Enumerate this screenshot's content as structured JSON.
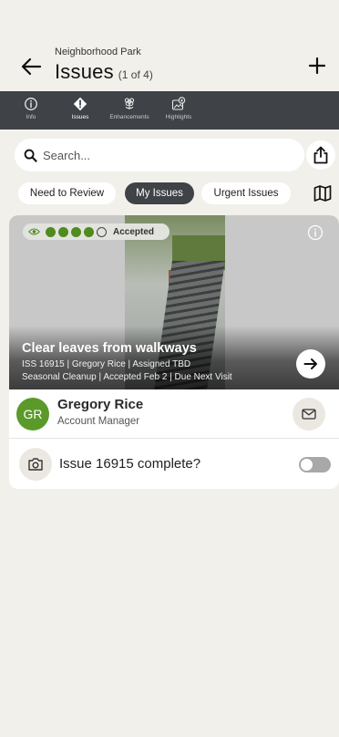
{
  "header": {
    "subtitle": "Neighborhood Park",
    "title": "Issues",
    "count": "(1 of 4)"
  },
  "tabs": [
    {
      "label": "Info",
      "icon": "info-icon"
    },
    {
      "label": "Issues",
      "icon": "alert-diamond-icon",
      "active": true
    },
    {
      "label": "Enhancements",
      "icon": "flower-icon"
    },
    {
      "label": "Highlights",
      "icon": "photo-star-icon"
    }
  ],
  "search": {
    "placeholder": "Search..."
  },
  "filters": [
    {
      "label": "Need to Review"
    },
    {
      "label": "My Issues",
      "active": true
    },
    {
      "label": "Urgent Issues"
    }
  ],
  "issue": {
    "status": "Accepted",
    "progress": {
      "filled": 4,
      "total": 5
    },
    "title": "Clear leaves from walkways",
    "meta_line1": "ISS 16915 | Gregory Rice | Assigned TBD",
    "meta_line2": "Seasonal Cleanup | Accepted Feb 2 | Due Next Visit"
  },
  "contact": {
    "initials": "GR",
    "name": "Gregory Rice",
    "role": "Account Manager"
  },
  "completion": {
    "label": "Issue 16915 complete?",
    "checked": false
  },
  "colors": {
    "accent_green": "#5b9a2a",
    "dark_bar": "#3f4247",
    "background": "#f2f0eb"
  }
}
